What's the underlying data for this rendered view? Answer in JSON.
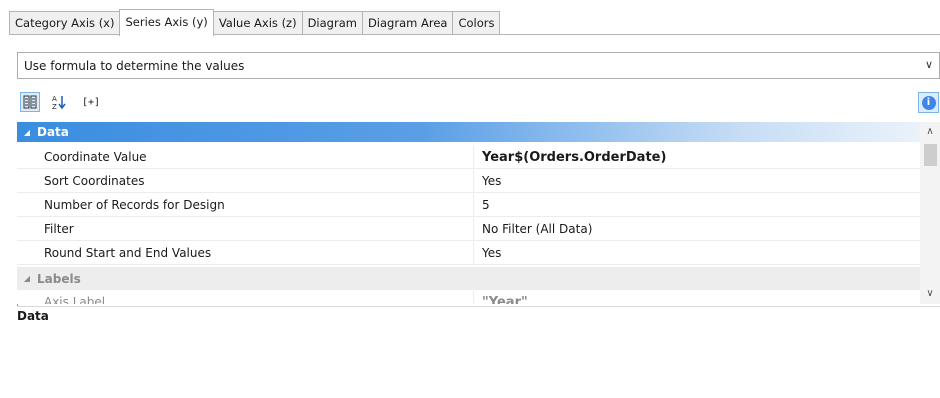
{
  "tabs": [
    {
      "label": "Category Axis (x)",
      "active": false
    },
    {
      "label": "Series Axis (y)",
      "active": true
    },
    {
      "label": "Value Axis (z)",
      "active": false
    },
    {
      "label": "Diagram",
      "active": false
    },
    {
      "label": "Diagram Area",
      "active": false
    },
    {
      "label": "Colors",
      "active": false
    }
  ],
  "mode_select": {
    "value": "Use formula to determine the values"
  },
  "toolbar": {
    "categorized_icon": "categorized-view-icon",
    "sort_icon": "sort-alphabetical-icon",
    "expand_label": "[+]",
    "info_icon": "info-icon"
  },
  "grid": {
    "category_data": "Data",
    "properties": [
      {
        "name": "Coordinate Value",
        "value": "Year$(Orders.OrderDate)",
        "bold": true
      },
      {
        "name": "Sort Coordinates",
        "value": "Yes",
        "bold": false
      },
      {
        "name": "Number of Records for Design",
        "value": "5",
        "bold": false
      },
      {
        "name": "Filter",
        "value": "No Filter (All Data)",
        "bold": false
      },
      {
        "name": "Round Start and End Values",
        "value": "Yes",
        "bold": false
      }
    ],
    "category_labels": "Labels",
    "partial_row": {
      "name": "Axis Label",
      "value": "\"Year\""
    }
  },
  "description": {
    "title": "Data"
  },
  "colors": {
    "accent": "#3a8de0",
    "selected_bg": "#dcecfc"
  }
}
